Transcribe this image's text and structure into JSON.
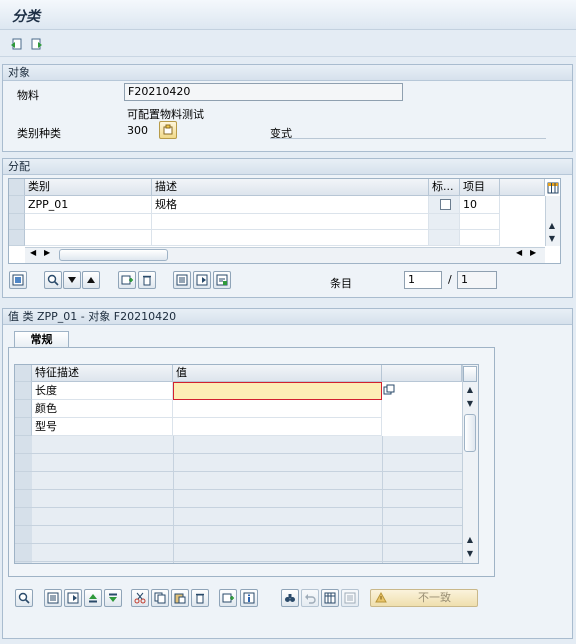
{
  "window": {
    "title": "分类"
  },
  "object_section": {
    "header": "对象",
    "material_label": "物料",
    "material_value": "F20210420",
    "material_desc": "可配置物料测试",
    "class_type_label": "类别种类",
    "class_type_value": "300",
    "variant_label": "变式"
  },
  "assignment_section": {
    "header": "分配",
    "columns": [
      "类别",
      "描述",
      "标...",
      "项目"
    ],
    "rows": [
      {
        "class": "ZPP_01",
        "desc": "规格",
        "std": false,
        "item": "10"
      }
    ],
    "entry_label": "条目",
    "entry_current": "1",
    "entry_sep": "/",
    "entry_total": "1"
  },
  "values_section": {
    "header": "值 类 ZPP_01 - 对象 F20210420",
    "tab_label": "常规",
    "columns": [
      "特征描述",
      "值"
    ],
    "rows": [
      {
        "char": "长度",
        "value": ""
      },
      {
        "char": "颜色",
        "value": ""
      },
      {
        "char": "型号",
        "value": ""
      }
    ],
    "inconsistent_button": "不一致"
  },
  "colors": {
    "background": "#e4ecf4",
    "required_field": "#fdedb5",
    "required_border": "#d2202f"
  }
}
